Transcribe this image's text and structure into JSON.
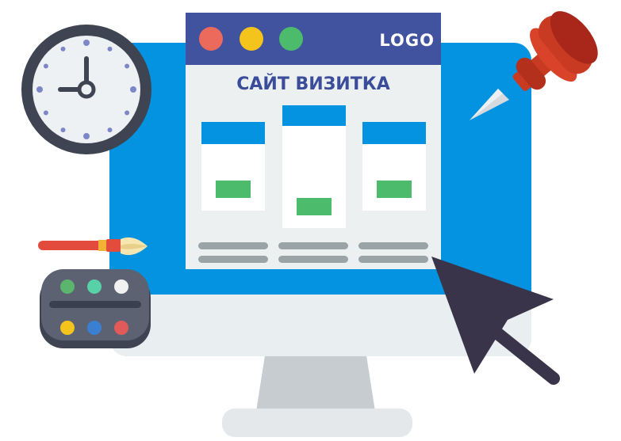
{
  "browser": {
    "logo": "LOGO",
    "title": "САЙТ ВИЗИТКА",
    "window_dots": [
      {
        "color": "#ec6a5c"
      },
      {
        "color": "#f4c41c"
      },
      {
        "color": "#4cbb6c"
      }
    ]
  },
  "palette": {
    "paint_colors": [
      "#5cb56c",
      "#58d0a8",
      "#f1f1f1",
      "#f4c41c",
      "#3b7fd0",
      "#e05a5a"
    ]
  },
  "icons": [
    "clock-icon",
    "pushpin-icon",
    "paintbrush-icon",
    "paint-palette-icon",
    "mouse-cursor-icon"
  ],
  "colors": {
    "screen_blue": "#0493e0",
    "browser_bar": "#41529e",
    "accent_green": "#4cbb6c",
    "cursor": "#3a344a",
    "pin_red": "#c83a22"
  }
}
